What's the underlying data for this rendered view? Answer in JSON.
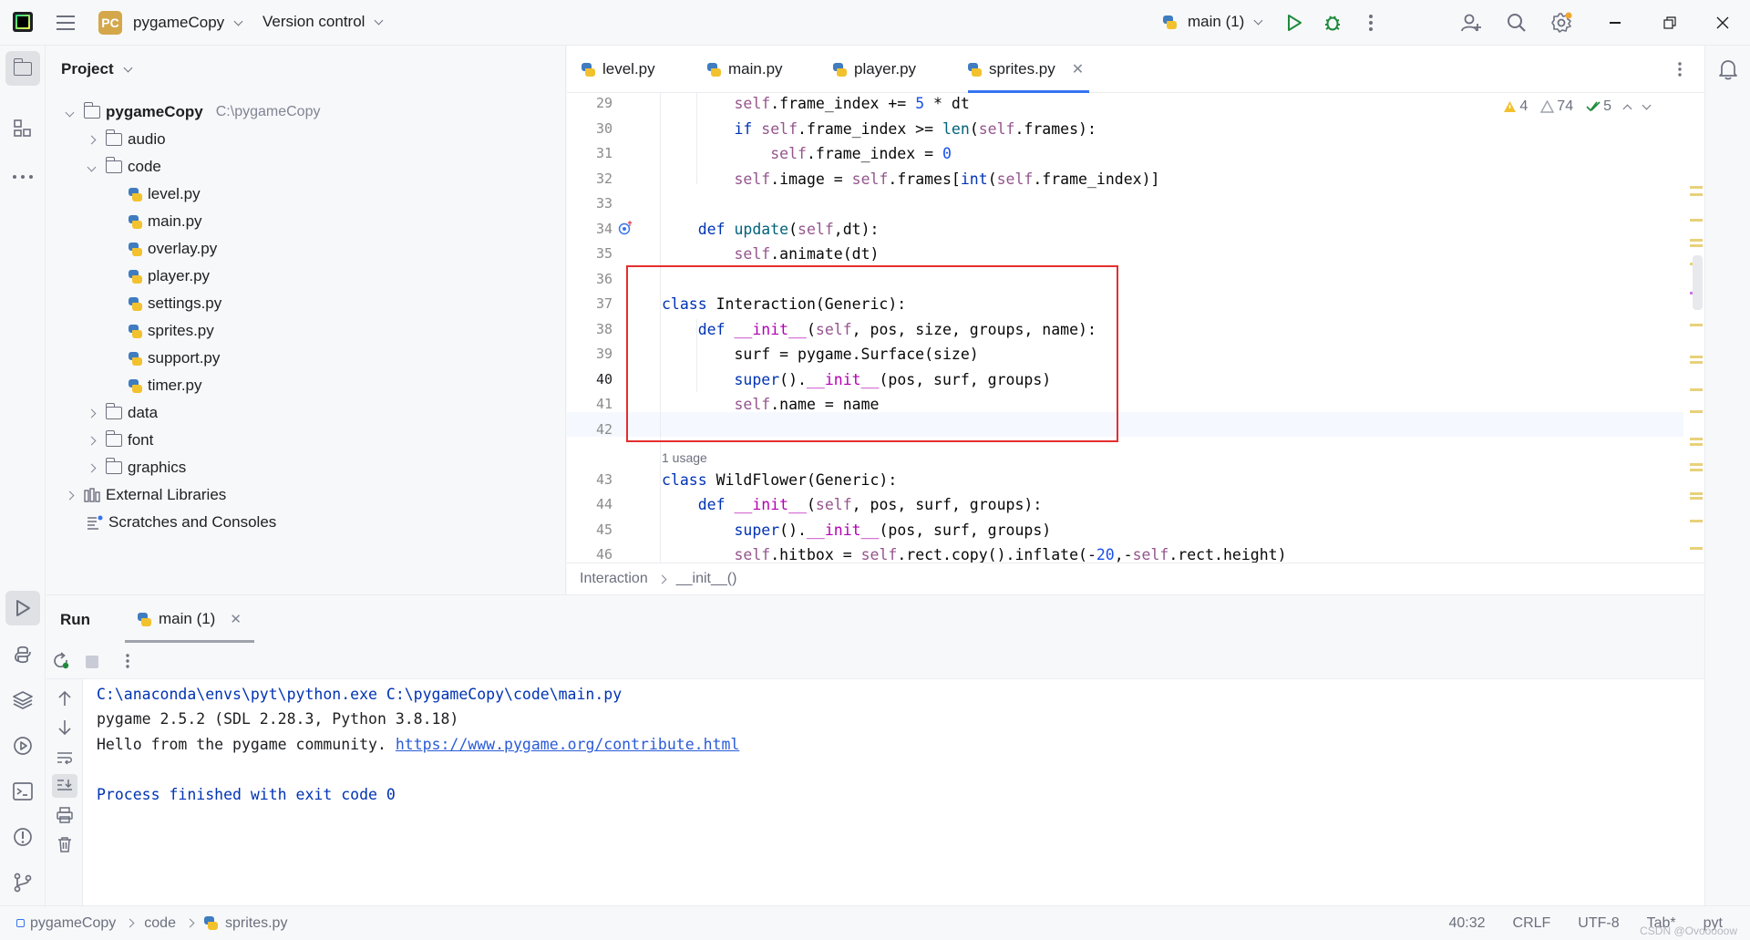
{
  "titlebar": {
    "project_badge": "PC",
    "project_name": "pygameCopy",
    "vcs_label": "Version control",
    "run_config": "main (1)"
  },
  "project_panel": {
    "title": "Project",
    "root_name": "pygameCopy",
    "root_path": "C:\\pygameCopy",
    "items": [
      {
        "label": "audio",
        "kind": "folder"
      },
      {
        "label": "code",
        "kind": "folder"
      },
      {
        "label": "level.py",
        "kind": "py"
      },
      {
        "label": "main.py",
        "kind": "py"
      },
      {
        "label": "overlay.py",
        "kind": "py"
      },
      {
        "label": "player.py",
        "kind": "py"
      },
      {
        "label": "settings.py",
        "kind": "py"
      },
      {
        "label": "sprites.py",
        "kind": "py"
      },
      {
        "label": "support.py",
        "kind": "py"
      },
      {
        "label": "timer.py",
        "kind": "py"
      },
      {
        "label": "data",
        "kind": "folder"
      },
      {
        "label": "font",
        "kind": "folder"
      },
      {
        "label": "graphics",
        "kind": "folder"
      },
      {
        "label": "External Libraries",
        "kind": "lib"
      },
      {
        "label": "Scratches and Consoles",
        "kind": "scratch"
      }
    ]
  },
  "editor": {
    "tabs": [
      {
        "label": "level.py"
      },
      {
        "label": "main.py"
      },
      {
        "label": "player.py"
      },
      {
        "label": "sprites.py"
      }
    ],
    "inspections": {
      "warnings": "4",
      "weak_warnings": "74",
      "ok": "5"
    },
    "line_numbers": [
      "29",
      "30",
      "31",
      "32",
      "33",
      "34",
      "35",
      "36",
      "37",
      "38",
      "39",
      "40",
      "41",
      "42",
      "43",
      "44",
      "45",
      "46"
    ],
    "usage_hint": "1 usage",
    "breadcrumb": [
      "Interaction",
      "__init__()"
    ]
  },
  "run_panel": {
    "title": "Run",
    "tab_label": "main (1)",
    "output": [
      "C:\\anaconda\\envs\\pyt\\python.exe C:\\pygameCopy\\code\\main.py",
      "pygame 2.5.2 (SDL 2.28.3, Python 3.8.18)",
      "Hello from the pygame community. ",
      "https://www.pygame.org/contribute.html",
      "Process finished with exit code 0"
    ]
  },
  "statusbar": {
    "crumbs": [
      "pygameCopy",
      "code",
      "sprites.py"
    ],
    "position": "40:32",
    "line_sep": "CRLF",
    "encoding": "UTF-8",
    "indent": "Tab*",
    "lang": "pyt",
    "watermark": "CSDN @Ovooooow"
  },
  "colors": {
    "accent": "#3574f0",
    "highlight_box": "#e52e2e"
  }
}
